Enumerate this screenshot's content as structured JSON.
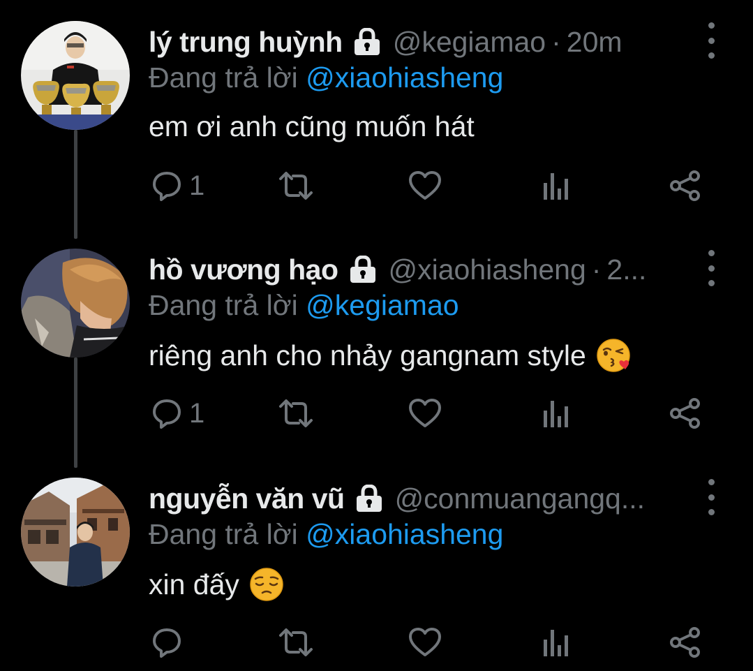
{
  "colors": {
    "background": "#000000",
    "primary_text": "#e7e9ea",
    "secondary_text": "#71767b",
    "accent": "#1d9bf0",
    "thread_line": "#3e4144"
  },
  "replying_label": "Đang trả lời",
  "tweets": [
    {
      "name": "lý trung huỳnh",
      "locked_icon": "lock-icon",
      "handle": "@kegiamao",
      "separator": "·",
      "time": "20m",
      "reply_to": "@xiaohiasheng",
      "text": "em ơi anh cũng muốn hát",
      "emoji": "",
      "reply_count": "1"
    },
    {
      "name": "hồ vương hạo",
      "locked_icon": "lock-icon",
      "handle": "@xiaohiasheng",
      "separator": "·",
      "time": "2...",
      "reply_to": "@kegiamao",
      "text": "riêng anh cho nhảy gangnam style",
      "emoji": "kissing-heart-emoji",
      "reply_count": "1"
    },
    {
      "name": "nguyễn văn vũ",
      "locked_icon": "lock-icon",
      "handle": "@conmuangangq...",
      "separator": "",
      "time": "",
      "reply_to": "@xiaohiasheng",
      "text": "xin đấy",
      "emoji": "pensive-emoji",
      "reply_count": ""
    }
  ]
}
